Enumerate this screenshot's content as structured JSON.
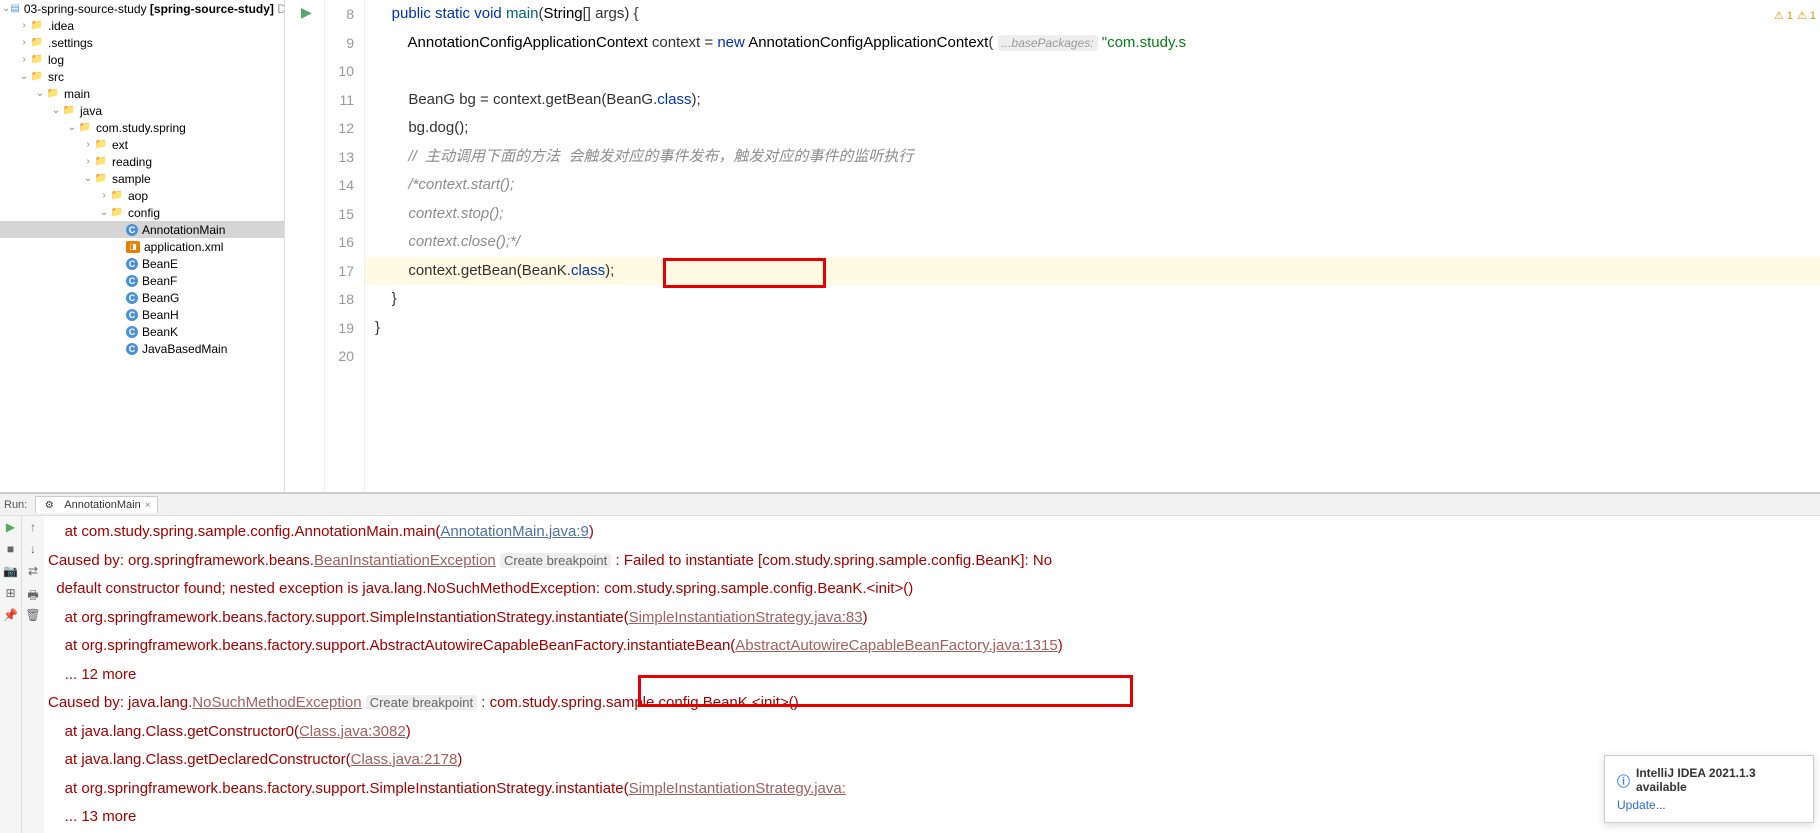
{
  "tree": {
    "root": "03-spring-source-study",
    "rootBold": "[spring-source-study]",
    "rootSuffix": "D:\\",
    "idea": ".idea",
    "settings": ".settings",
    "log": "log",
    "src": "src",
    "main": "main",
    "java": "java",
    "pkg": "com.study.spring",
    "ext": "ext",
    "reading": "reading",
    "sample": "sample",
    "aop": "aop",
    "config": "config",
    "AnnotationMain": "AnnotationMain",
    "applicationXml": "application.xml",
    "BeanE": "BeanE",
    "BeanF": "BeanF",
    "BeanG": "BeanG",
    "BeanH": "BeanH",
    "BeanK": "BeanK",
    "JavaBasedMain": "JavaBasedMain"
  },
  "editor": {
    "warn1": "⚠ 1",
    "warn2": "⚠ 1",
    "lineStart": 8,
    "kw_public": "public",
    "kw_static": "static",
    "kw_void": "void",
    "kw_new": "new",
    "m_main": "main",
    "t_string": "String",
    "t_args": "[] args) {",
    "t_ctx": "AnnotationConfigApplicationContext",
    "t_ctxv": " context = ",
    "hint_base": "...basePackages:",
    "str_pkg": "\"com.study.s",
    "l10": "        BeanG bg = context.getBean(BeanG.",
    "l10b": "class",
    "l10c": ");",
    "l11": "        bg.dog();",
    "cmt1": "//  主动调用下面的方法  会触发对应的事件发布，触发对应的事件的监听执行",
    "cmt2": "/*context.start();",
    "cmt3": "context.stop();",
    "cmt4": "context.close();*/",
    "l17a": "        context.getBean(BeanK.",
    "l17b": "class",
    "l17c": ");",
    "l18": "    }",
    "l19": "}"
  },
  "tabs": {
    "runLabel": "Run:",
    "tab": "AnnotationMain"
  },
  "console": {
    "l1a": "    at com.study.spring.sample.config.AnnotationMain.main(",
    "l1link": "AnnotationMain.java:9",
    "l1b": ")",
    "l2a": "Caused by: org.springframework.beans.",
    "l2ex": "BeanInstantiationException",
    "l2bp": "Create breakpoint",
    "l2b": " : Failed to instantiate [com.study.spring.sample.config.BeanK]: No",
    "l3": "  default constructor found; nested exception is java.lang.NoSuchMethodException: com.study.spring.sample.config.BeanK.<init>()",
    "l4a": "    at org.springframework.beans.factory.support.SimpleInstantiationStrategy.instantiate(",
    "l4link": "SimpleInstantiationStrategy.java:83",
    "l4b": ")",
    "l5a": "    at org.springframework.beans.factory.support.AbstractAutowireCapableBeanFactory.instantiateBean(",
    "l5link": "AbstractAutowireCapableBeanFactory.java:1315",
    "l5b": ")",
    "l6": "    ... 12 more",
    "l7a": "Caused by: java.lang.",
    "l7ex": "NoSuchMethodException",
    "l7bp": "Create breakpoint",
    "l7b": ": com.study.spring.sample.config.BeanK.<init>()",
    "l8a": "    at java.lang.Class.getConstructor0(",
    "l8link": "Class.java:3082",
    "l8b": ")",
    "l9a": "    at java.lang.Class.getDeclaredConstructor(",
    "l9link": "Class.java:2178",
    "l9b": ")",
    "l10a": "    at org.springframework.beans.factory.support.SimpleInstantiationStrategy.instantiate(",
    "l10link": "SimpleInstantiationStrategy.java:",
    "l11": "    ... 13 more"
  },
  "notif": {
    "title": "IntelliJ IDEA 2021.1.3 available",
    "update": "Update..."
  }
}
